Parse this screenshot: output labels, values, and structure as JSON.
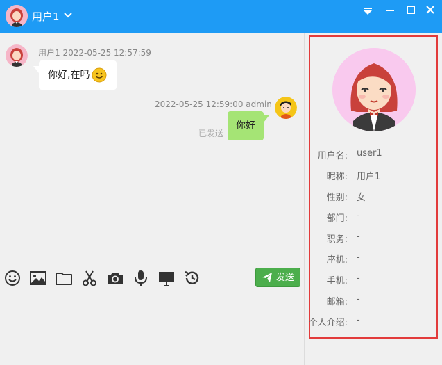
{
  "titlebar": {
    "username": "用户1",
    "color": "#1e9bf5"
  },
  "messages": [
    {
      "side": "left",
      "sender": "用户1",
      "time": "2022-05-25 12:57:59",
      "text": "你好,在吗",
      "emoji": "smiley-emoji"
    },
    {
      "side": "right",
      "sender": "admin",
      "time": "2022-05-25 12:59:00",
      "text": "你好",
      "status": "已发送"
    }
  ],
  "toolbar": {
    "tools": [
      "emoji-icon",
      "image-icon",
      "folder-icon",
      "scissors-icon",
      "camera-icon",
      "microphone-icon",
      "monitor-icon",
      "history-icon"
    ],
    "send_label": "发送",
    "send_color": "#4cae4c"
  },
  "profile": {
    "border_color": "#e23b3b",
    "fields": [
      {
        "label": "用户名:",
        "value": "user1"
      },
      {
        "label": "昵称:",
        "value": "用户1"
      },
      {
        "label": "性别:",
        "value": "女"
      },
      {
        "label": "部门:",
        "value": "-"
      },
      {
        "label": "职务:",
        "value": "-"
      },
      {
        "label": "座机:",
        "value": "-"
      },
      {
        "label": "手机:",
        "value": "-"
      },
      {
        "label": "邮箱:",
        "value": "-"
      },
      {
        "label": "个人介绍:",
        "value": "-"
      }
    ]
  }
}
